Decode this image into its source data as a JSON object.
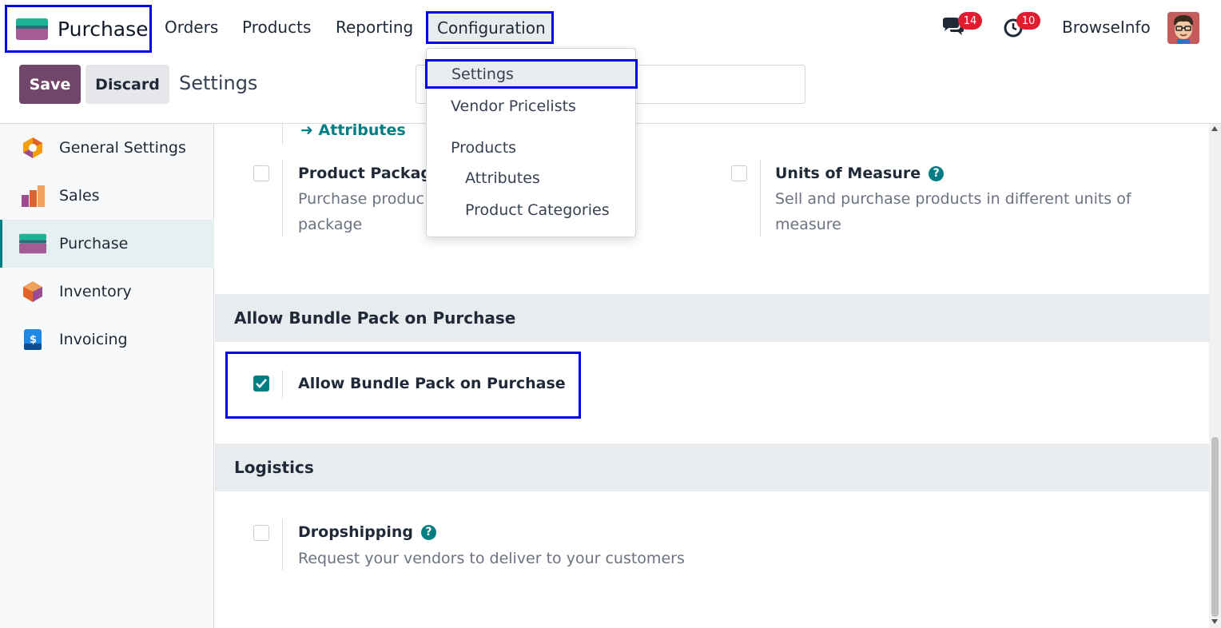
{
  "navbar": {
    "app_name": "Purchase",
    "menu": [
      "Orders",
      "Products",
      "Reporting"
    ],
    "active_menu": "Configuration",
    "messages_count": "14",
    "activities_count": "10",
    "company": "BrowseInfo",
    "icons": {
      "messages": "chat-bubbles-icon",
      "activities": "clock-icon"
    }
  },
  "controls": {
    "save_label": "Save",
    "discard_label": "Discard",
    "title": "Settings"
  },
  "dropdown": {
    "settings": "Settings",
    "vendor_pricelists": "Vendor Pricelists",
    "products_header": "Products",
    "attributes": "Attributes",
    "product_categories": "Product Categories"
  },
  "sidebar": {
    "items": [
      "General Settings",
      "Sales",
      "Purchase",
      "Inventory",
      "Invoicing"
    ],
    "active": "Purchase"
  },
  "content": {
    "attributes_link": "Attributes",
    "product_packaging": {
      "title": "Product Packagi",
      "desc_line1": "Purchase produc",
      "desc_line2": "package",
      "checked": false
    },
    "units_of_measure": {
      "title": "Units of Measure",
      "desc_line1": "Sell and purchase products in different units of",
      "desc_line2": "measure",
      "checked": false
    },
    "bundle_section": {
      "header": "Allow Bundle Pack on Purchase",
      "setting_title": "Allow Bundle Pack on Purchase",
      "checked": true
    },
    "logistics_section": {
      "header": "Logistics",
      "dropshipping_title": "Dropshipping",
      "dropshipping_desc": "Request your vendors to deliver to your customers",
      "checked": false
    }
  },
  "colors": {
    "primary": "#71466b",
    "accent": "#017e84",
    "highlight_border": "#0000e6",
    "badge": "#e01d2f"
  }
}
